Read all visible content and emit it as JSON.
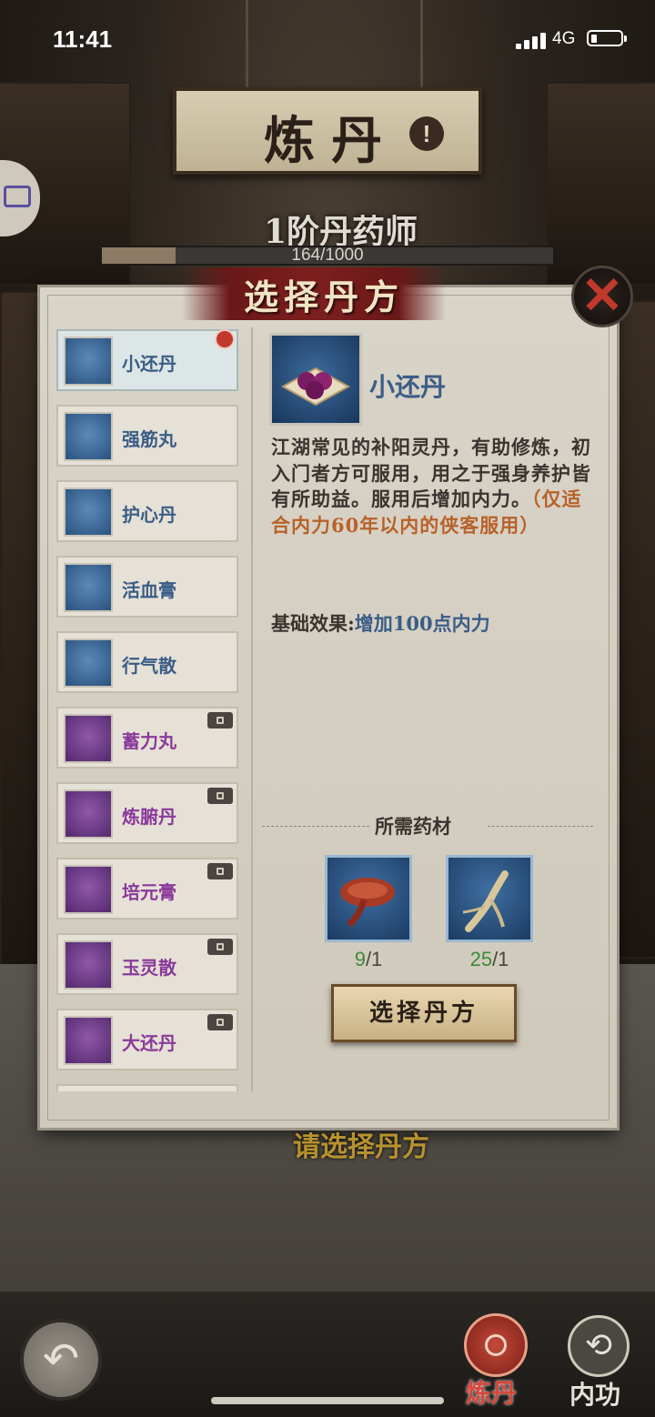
{
  "status_bar": {
    "time": "11:41",
    "network": "4G"
  },
  "sign": {
    "title": "炼丹",
    "info_icon": "!"
  },
  "rank": {
    "title": "1阶丹药师",
    "exp_text": "164/1000",
    "exp_fraction": 0.164
  },
  "dialog": {
    "title": "选择丹方",
    "close_icon": "✕",
    "recipes": [
      {
        "name": "小还丹",
        "color": "#3b5d87",
        "locked": false,
        "selected": true,
        "new": true
      },
      {
        "name": "强筋丸",
        "color": "#3b5d87",
        "locked": false,
        "selected": false,
        "new": false
      },
      {
        "name": "护心丹",
        "color": "#3b5d87",
        "locked": false,
        "selected": false,
        "new": false
      },
      {
        "name": "活血膏",
        "color": "#3b5d87",
        "locked": false,
        "selected": false,
        "new": false
      },
      {
        "name": "行气散",
        "color": "#3b5d87",
        "locked": false,
        "selected": false,
        "new": false
      },
      {
        "name": "蓄力丸",
        "color": "#8a3a9a",
        "locked": true,
        "selected": false,
        "new": false
      },
      {
        "name": "炼腑丹",
        "color": "#8a3a9a",
        "locked": true,
        "selected": false,
        "new": false
      },
      {
        "name": "培元膏",
        "color": "#8a3a9a",
        "locked": true,
        "selected": false,
        "new": false
      },
      {
        "name": "玉灵散",
        "color": "#8a3a9a",
        "locked": true,
        "selected": false,
        "new": false
      },
      {
        "name": "大还丹",
        "color": "#8a3a9a",
        "locked": true,
        "selected": false,
        "new": false
      }
    ],
    "detail": {
      "name": "小还丹",
      "description": "江湖常见的补阳灵丹，有助修炼，初入门者方可服用，用之于强身养护皆有所助益。服用后增加内力。",
      "restriction": "（仅适合内力60年以内的侠客服用）",
      "base_effect_label": "基础效果:",
      "base_effect_value": "增加100点内力"
    },
    "materials_title": "所需药材",
    "materials": [
      {
        "icon": "lingzhi-icon",
        "have": "9",
        "need": "/1"
      },
      {
        "icon": "ginseng-icon",
        "have": "25",
        "need": "/1"
      }
    ],
    "select_button": "选择丹方"
  },
  "hint_text": "请选择丹方",
  "bottom_bar": {
    "back_icon": "↶",
    "alchemy_label": "炼丹",
    "neigong_label": "内功",
    "neigong_icon": "⟲"
  }
}
